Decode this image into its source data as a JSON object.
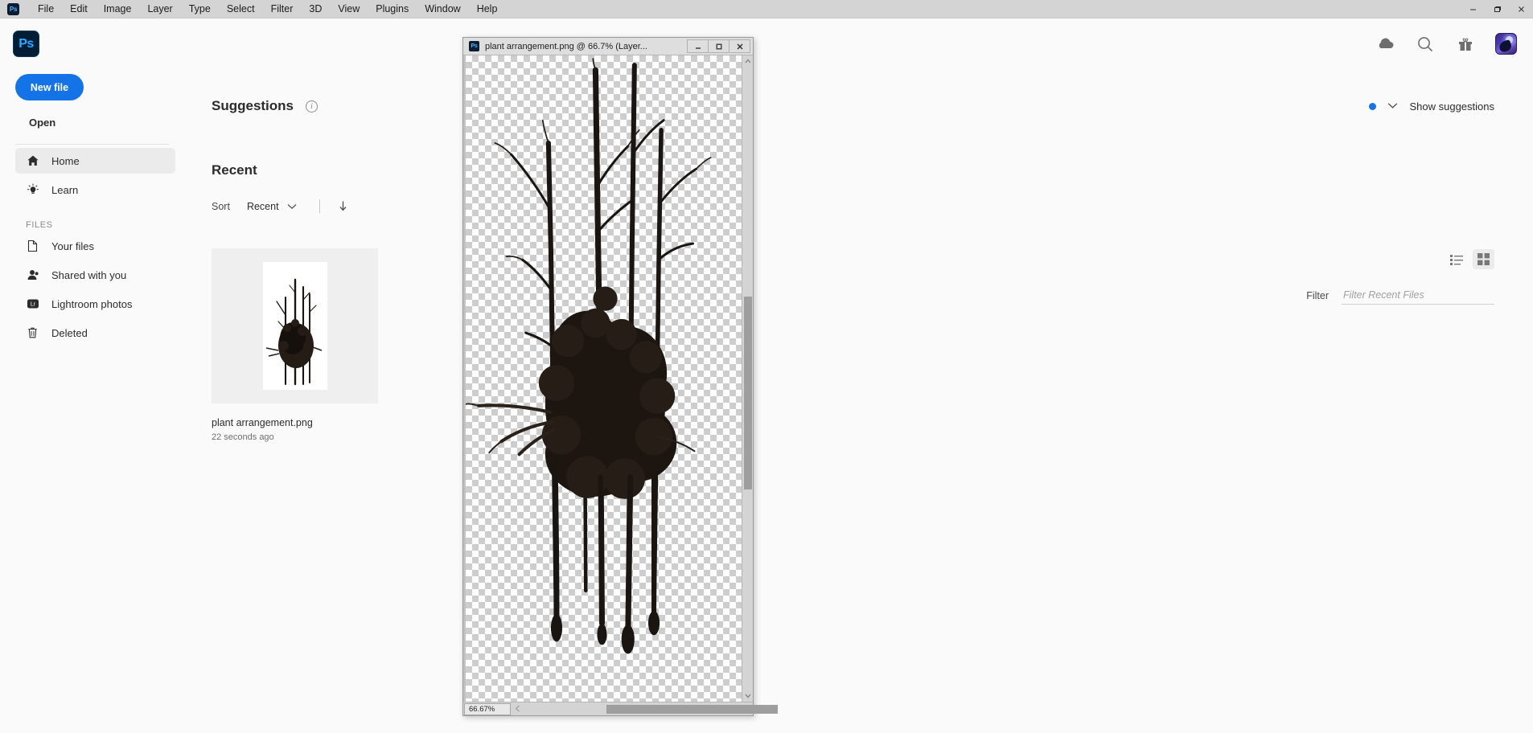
{
  "menubar": {
    "logo": "Ps",
    "items": [
      "File",
      "Edit",
      "Image",
      "Layer",
      "Type",
      "Select",
      "Filter",
      "3D",
      "View",
      "Plugins",
      "Window",
      "Help"
    ],
    "window_controls": {
      "minimize": "—",
      "restore": "❐",
      "close": "✕"
    }
  },
  "homebar": {
    "logo": "Ps",
    "icons": [
      "cloud-icon",
      "search-icon",
      "gift-icon",
      "avatar"
    ]
  },
  "sidebar": {
    "new_file_label": "New file",
    "open_label": "Open",
    "items": [
      {
        "label": "Home",
        "icon": "home-icon",
        "active": true
      },
      {
        "label": "Learn",
        "icon": "lightbulb-icon",
        "active": false
      }
    ],
    "files_header": "FILES",
    "file_items": [
      {
        "label": "Your files",
        "icon": "document-icon"
      },
      {
        "label": "Shared with you",
        "icon": "person-icon"
      },
      {
        "label": "Lightroom photos",
        "icon": "lightroom-icon"
      },
      {
        "label": "Deleted",
        "icon": "trash-icon"
      }
    ],
    "lightroom_badge": "Lr"
  },
  "main": {
    "suggestions_title": "Suggestions",
    "suggestions_info_icon": "info-icon",
    "show_suggestions_label": "Show suggestions",
    "recent_title": "Recent",
    "sort_label": "Sort",
    "sort_value": "Recent",
    "sort_direction_icon": "arrow-down-icon",
    "view_list_icon": "list-view-icon",
    "view_grid_icon": "grid-view-icon",
    "active_view": "grid",
    "filter_label": "Filter",
    "filter_placeholder": "Filter Recent Files",
    "filter_value": "",
    "accent_color": "#1473e6"
  },
  "recent_files": [
    {
      "name": "plant arrangement.png",
      "time": "22 seconds ago"
    }
  ],
  "document_window": {
    "title": "plant arrangement.png @ 66.7% (Layer...",
    "logo": "Ps",
    "controls": {
      "minimize": "—",
      "maximize": "❐",
      "close": "✕"
    },
    "zoom_level": "66.67%",
    "scroll_up_icon": "caret-up-icon",
    "scroll_down_icon": "caret-down-icon",
    "scroll_left_icon": "caret-left-icon",
    "scroll_right_icon": "caret-right-icon"
  }
}
